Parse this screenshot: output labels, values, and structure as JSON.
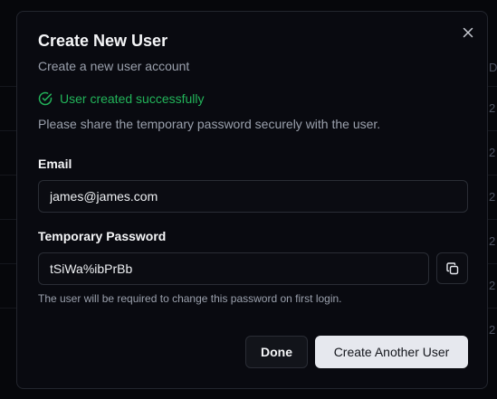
{
  "background": {
    "column_header": "D",
    "cells": [
      "2",
      "2",
      "2",
      "2",
      "2",
      "2"
    ]
  },
  "dialog": {
    "title": "Create New User",
    "subtitle": "Create a new user account",
    "success_message": "User created successfully",
    "info_message": "Please share the temporary password securely with the user.",
    "email_label": "Email",
    "email_value": "james@james.com",
    "password_label": "Temporary Password",
    "password_value": "tSiWa%ibPrBb",
    "password_hint": "The user will be required to change this password on first login.",
    "done_label": "Done",
    "create_another_label": "Create Another User"
  },
  "icons": {
    "close": "close-icon",
    "success": "check-circle-icon",
    "copy": "copy-icon"
  },
  "colors": {
    "success": "#22b45a",
    "primary_button": "#e6e8ee",
    "dialog_bg": "#090a10"
  }
}
